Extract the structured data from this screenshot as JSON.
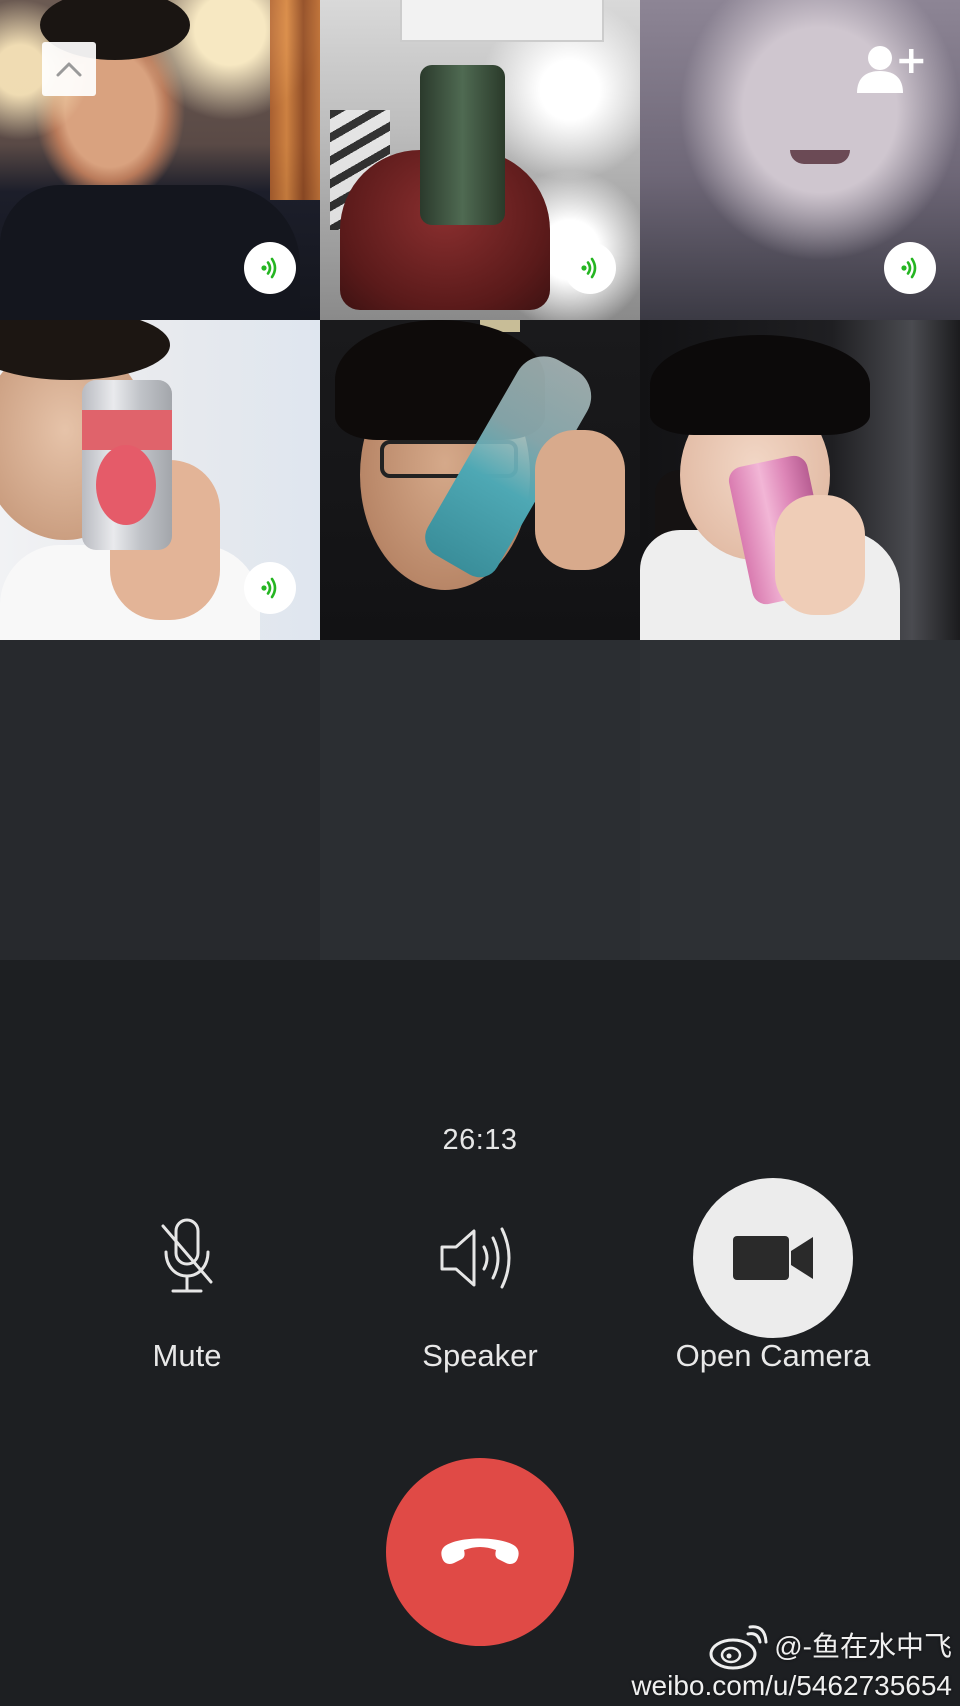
{
  "call": {
    "duration": "26:13",
    "participants": [
      {
        "slot": 1,
        "speaking": true
      },
      {
        "slot": 2,
        "speaking": true
      },
      {
        "slot": 3,
        "speaking": true
      },
      {
        "slot": 4,
        "speaking": true
      },
      {
        "slot": 5,
        "speaking": false
      },
      {
        "slot": 6,
        "speaking": false
      }
    ],
    "empty_slots": 3
  },
  "top_controls": {
    "collapse_icon": "chevron-up-icon",
    "add_member_icon": "add-user-icon"
  },
  "controls": {
    "mute_label": "Mute",
    "mute_icon": "microphone-off-icon",
    "speaker_label": "Speaker",
    "speaker_icon": "speaker-volume-icon",
    "camera_label": "Open Camera",
    "camera_icon": "video-camera-icon",
    "hangup_icon": "hang-up-phone-icon"
  },
  "colors": {
    "background": "#1d1f22",
    "hangup": "#e04a46",
    "speaking_indicator": "#25b522",
    "camera_button": "#ececec"
  },
  "watermark": {
    "handle": "@-鱼在水中飞",
    "url": "weibo.com/u/5462735654"
  }
}
